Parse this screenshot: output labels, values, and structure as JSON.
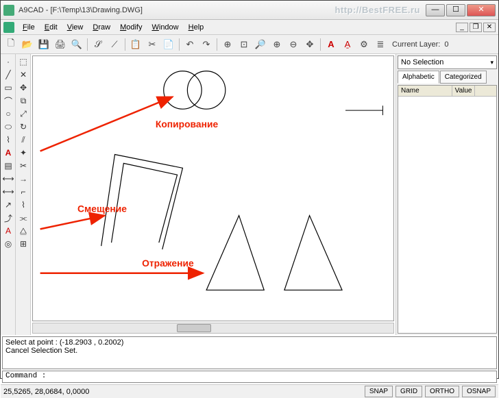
{
  "title": "A9CAD - [F:\\Temp\\13\\Drawing.DWG]",
  "watermark": "http://BestFREE.ru",
  "menu": {
    "file": "File",
    "edit": "Edit",
    "view": "View",
    "draw": "Draw",
    "modify": "Modify",
    "window": "Window",
    "help": "Help"
  },
  "toolbar": {
    "layer_label": "Current Layer:",
    "layer_value": "0"
  },
  "prop": {
    "selection": "No Selection",
    "tab_alpha": "Alphabetic",
    "tab_cat": "Categorized",
    "col_name": "Name",
    "col_value": "Value"
  },
  "annotations": {
    "copy": "Копирование",
    "offset": "Смещение",
    "mirror": "Отражение"
  },
  "cmd": {
    "line1": "Select at point : (-18.2903 , 0.2002)",
    "line2": "Cancel Selection Set.",
    "prompt": "Command :"
  },
  "status": {
    "coords": "25,5265, 28,0684, 0,0000",
    "snap": "SNAP",
    "grid": "GRID",
    "ortho": "ORTHO",
    "osnap": "OSNAP"
  }
}
